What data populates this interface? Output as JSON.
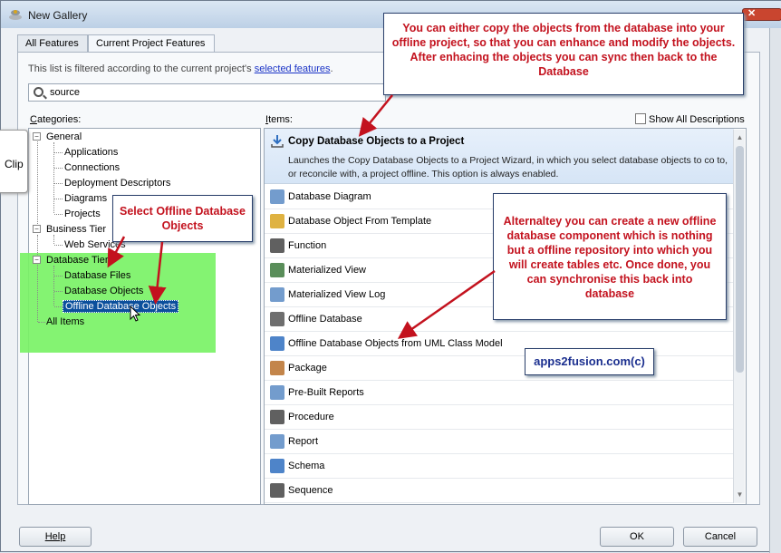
{
  "window": {
    "title": "New Gallery"
  },
  "tabs": [
    {
      "label": "All Features",
      "active": false
    },
    {
      "label": "Current Project Features",
      "active": true
    }
  ],
  "filter": {
    "text": "This list is filtered according to the current project's ",
    "link": "selected features",
    "end": "."
  },
  "search": {
    "value": "source"
  },
  "categories": {
    "label_prefix": "",
    "label_u": "C",
    "label_rest": "ategories:",
    "tree": [
      {
        "label": "General",
        "level": 0,
        "expanded": true
      },
      {
        "label": "Applications",
        "level": 1
      },
      {
        "label": "Connections",
        "level": 1
      },
      {
        "label": "Deployment Descriptors",
        "level": 1
      },
      {
        "label": "Diagrams",
        "level": 1
      },
      {
        "label": "Projects",
        "level": 1
      },
      {
        "label": "Business Tier",
        "level": 0,
        "expanded": true
      },
      {
        "label": "Web Services",
        "level": 1
      },
      {
        "label": "Database Tier",
        "level": 0,
        "expanded": true
      },
      {
        "label": "Database Files",
        "level": 1
      },
      {
        "label": "Database Objects",
        "level": 1
      },
      {
        "label": "Offline Database Objects",
        "level": 1,
        "selected": true
      },
      {
        "label": "All Items",
        "level": 0
      }
    ]
  },
  "items": {
    "label_u": "I",
    "label_rest": "tems:",
    "show_all": "Show All Descriptions",
    "first": {
      "name": "Copy Database Objects to a Project",
      "desc": "Launches the Copy Database Objects to a Project Wizard, in which you select database objects to co to, or reconcile with, a project offline. This option is always enabled."
    },
    "list": [
      {
        "name": "Database Diagram",
        "icon": "diagram-icon",
        "color": "#5a8bc4"
      },
      {
        "name": "Database Object From Template",
        "icon": "template-icon",
        "color": "#d9a520"
      },
      {
        "name": "Function",
        "icon": "function-icon",
        "color": "#444444"
      },
      {
        "name": "Materialized View",
        "icon": "materialized-view-icon",
        "color": "#3d7a3d"
      },
      {
        "name": "Materialized View Log",
        "icon": "materialized-view-log-icon",
        "color": "#5a8bc4"
      },
      {
        "name": "Offline Database",
        "icon": "database-icon",
        "color": "#555555"
      },
      {
        "name": "Offline Database Objects from UML Class Model",
        "icon": "uml-icon",
        "color": "#2f6fc0"
      },
      {
        "name": "Package",
        "icon": "package-icon",
        "color": "#b8702a"
      },
      {
        "name": "Pre-Built Reports",
        "icon": "reports-icon",
        "color": "#5a8bc4"
      },
      {
        "name": "Procedure",
        "icon": "procedure-icon",
        "color": "#444444"
      },
      {
        "name": "Report",
        "icon": "report-icon",
        "color": "#5a8bc4"
      },
      {
        "name": "Schema",
        "icon": "schema-icon",
        "color": "#2f6fc0"
      },
      {
        "name": "Sequence",
        "icon": "sequence-icon",
        "color": "#444444"
      }
    ]
  },
  "buttons": {
    "help": "Help",
    "ok": "OK",
    "cancel": "Cancel"
  },
  "clip": {
    "label": "Clip"
  },
  "callouts": {
    "top": "You can either copy the objects from the database into your offline project, so that you can enhance and modify the objects. After enhacing the objects you can sync then back to the Database",
    "left": "Select Offline Database Objects",
    "right": "Alternaltey you can create a new offline database component which is nothing but a offline repository into which you will create tables etc. Once done, you can synchronise this back into database",
    "watermark": "apps2fusion.com(c)"
  }
}
